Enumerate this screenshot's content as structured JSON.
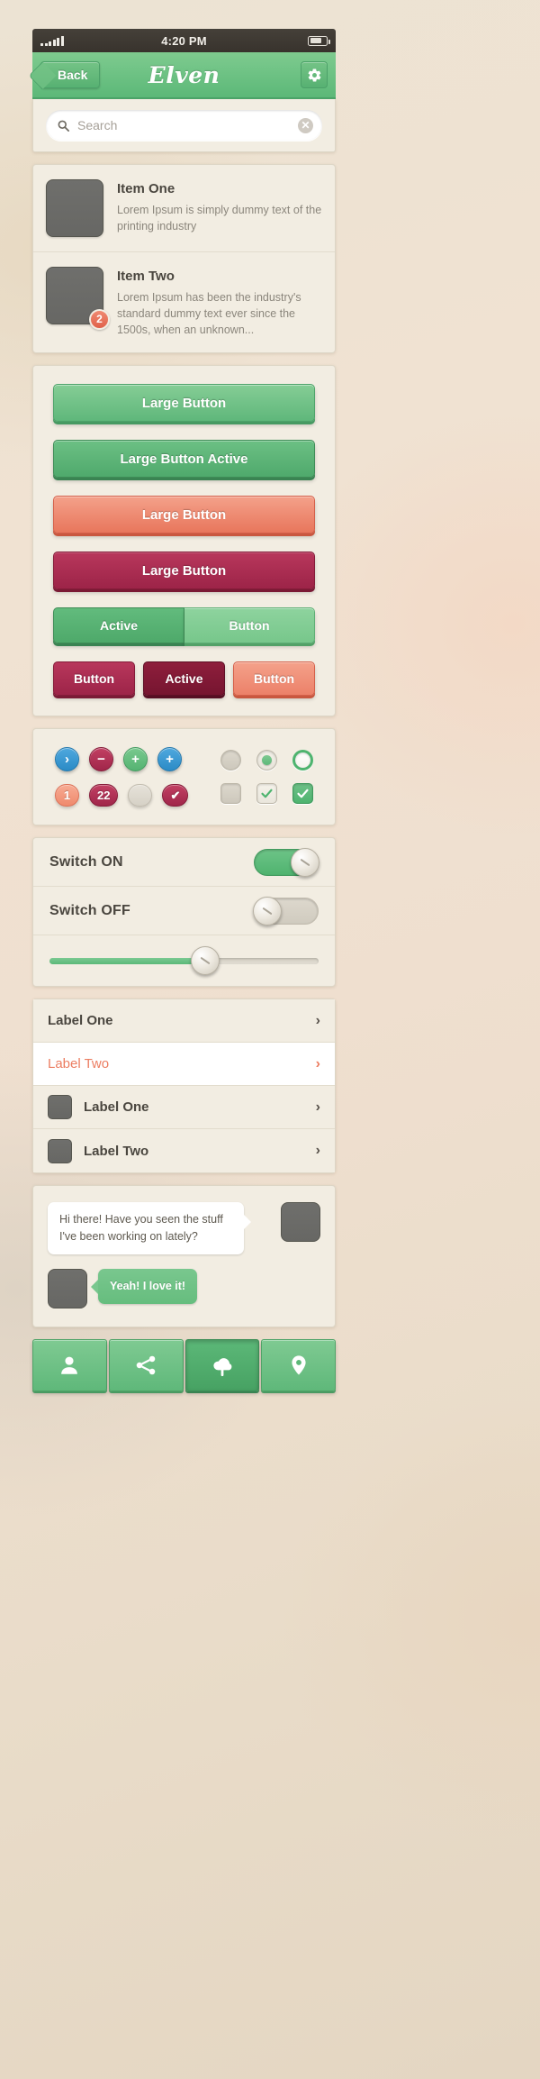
{
  "statusbar": {
    "time": "4:20 PM",
    "signal_icon": "signal-bars-icon",
    "battery_icon": "battery-icon"
  },
  "navbar": {
    "back_label": "Back",
    "title": "Elven",
    "gear_icon": "gear-icon"
  },
  "search": {
    "placeholder": "Search",
    "value": "",
    "search_icon": "search-icon",
    "clear_icon": "clear-icon",
    "clear_glyph": "✕"
  },
  "list": {
    "items": [
      {
        "title": "Item One",
        "desc": "Lorem Ipsum is simply dummy text of the printing industry",
        "badge": ""
      },
      {
        "title": "Item Two",
        "desc": "Lorem Ipsum has been the industry's standard dummy text ever since the 1500s, when an unknown...",
        "badge": "2"
      }
    ]
  },
  "buttons": {
    "large": [
      {
        "label": "Large Button",
        "style": "green-light"
      },
      {
        "label": "Large Button Active",
        "style": "green-dark"
      },
      {
        "label": "Large Button",
        "style": "salmon"
      },
      {
        "label": "Large Button",
        "style": "crimson"
      }
    ],
    "segmented": [
      {
        "label": "Active",
        "state": "on"
      },
      {
        "label": "Button",
        "state": "off"
      }
    ],
    "trio": [
      {
        "label": "Button",
        "style": "crimson"
      },
      {
        "label": "Active",
        "style": "crimson-dark"
      },
      {
        "label": "Button",
        "style": "salmon"
      }
    ]
  },
  "controls": {
    "circle_buttons": [
      {
        "icon": "chevron-right-icon",
        "glyph": "›",
        "color": "#2b8bc6"
      },
      {
        "icon": "minus-icon",
        "glyph": "−",
        "color": "#a0264a"
      },
      {
        "icon": "plus-icon",
        "glyph": "+",
        "color": "#55b372"
      },
      {
        "icon": "plus-icon",
        "glyph": "+",
        "color": "#2b8bc6"
      }
    ],
    "badges": [
      {
        "label": "1",
        "style": "salmon"
      },
      {
        "label": "22",
        "style": "crimson"
      },
      {
        "label": "",
        "style": "gray"
      },
      {
        "label": "✔",
        "style": "crimson"
      }
    ],
    "radios": [
      "empty",
      "dot",
      "ring"
    ],
    "checkboxes": [
      "empty",
      "check-gray",
      "check-green"
    ],
    "check_glyph": "✔"
  },
  "switches": [
    {
      "label": "Switch  ON",
      "state": "on"
    },
    {
      "label": "Switch  OFF",
      "state": "off"
    }
  ],
  "slider": {
    "value_percent": 58
  },
  "labels": [
    {
      "text": "Label One",
      "style": "plain",
      "thumb": false,
      "chevron": "›"
    },
    {
      "text": "Label Two",
      "style": "highlight",
      "thumb": false,
      "chevron": "›"
    },
    {
      "text": "Label One",
      "style": "plain",
      "thumb": true,
      "chevron": "›"
    },
    {
      "text": "Label Two",
      "style": "plain",
      "thumb": true,
      "chevron": "›"
    }
  ],
  "chat": [
    {
      "text": "Hi there! Have you seen the stuff I've been working on lately?",
      "side": "left",
      "avatar_icon": "avatar-icon"
    },
    {
      "text": "Yeah! I love it!",
      "side": "right",
      "avatar_icon": "avatar-icon"
    }
  ],
  "tabbar": [
    {
      "icon": "person-icon",
      "active": false
    },
    {
      "icon": "share-icon",
      "active": false
    },
    {
      "icon": "cloud-upload-icon",
      "active": true
    },
    {
      "icon": "location-pin-icon",
      "active": false
    }
  ],
  "colors": {
    "green": "#5cb878",
    "green_light": "#85cd95",
    "salmon": "#ec8169",
    "crimson": "#a0264a",
    "blue": "#2b8bc6",
    "cream": "#f2ede2",
    "dark_text": "#4a463f"
  }
}
